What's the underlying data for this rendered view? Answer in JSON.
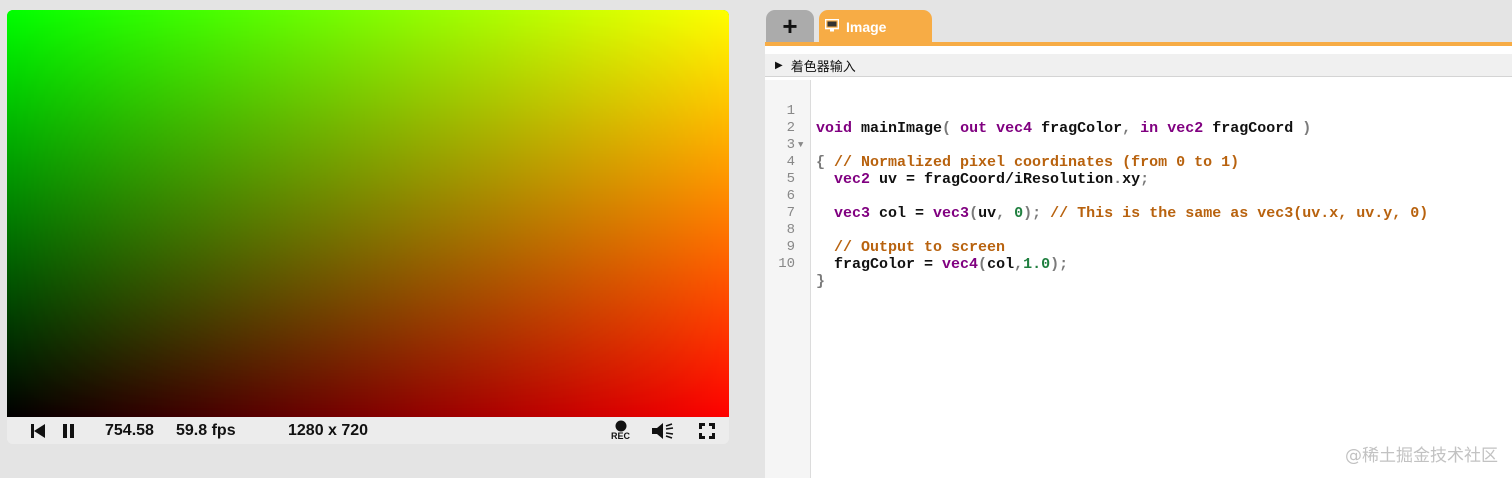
{
  "player": {
    "time": "754.58",
    "fps": "59.8 fps",
    "resolution": "1280 x 720",
    "rec_label": "REC"
  },
  "tabs": {
    "add_label": "+",
    "image_label": "Image"
  },
  "shader_inputs_label": "着色器输入",
  "code": {
    "line_numbers": [
      "1",
      "2",
      "3",
      "4",
      "5",
      "6",
      "7",
      "8",
      "9",
      "10"
    ]
  },
  "watermark": "@稀土掘金技术社区",
  "colors": {
    "tab_accent": "#f7ac45",
    "keyword": "#800080",
    "comment": "#b8620e",
    "number": "#1f7f3f"
  }
}
